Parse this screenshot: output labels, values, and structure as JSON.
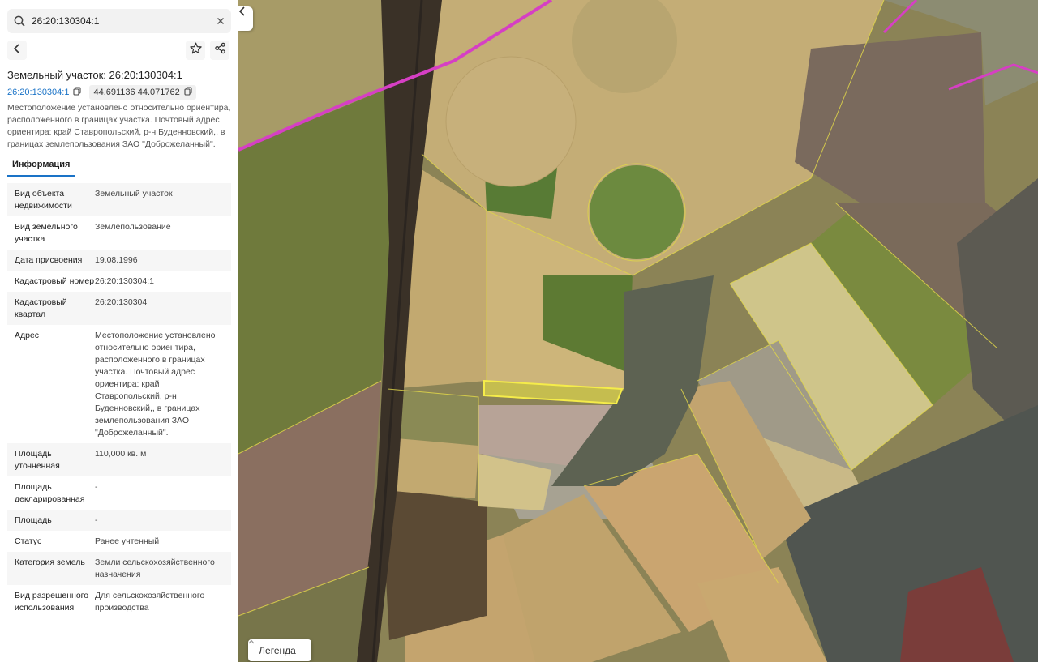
{
  "search": {
    "value": "26:20:130304:1",
    "search_icon": "search-icon",
    "clear_icon": "close-icon"
  },
  "panel": {
    "back_icon": "arrow-left-icon",
    "favorite_icon": "star-icon",
    "share_icon": "share-icon",
    "title": "Земельный участок: 26:20:130304:1",
    "cadastral_link": "26:20:130304:1",
    "coordinates": "44.691136 44.071762",
    "copy_icon": "copy-icon",
    "location_description": "Местоположение установлено относительно ориентира, расположенного в границах участка. Почтовый адрес ориентира: край Ставропольский, р-н Буденновский,, в границах землепользования ЗАО \"Доброжеланный\".",
    "tab_info": "Информация",
    "accent_color": "#1a73c7"
  },
  "info": [
    {
      "label": "Вид объекта недвижимости",
      "value": "Земельный участок"
    },
    {
      "label": "Вид земельного участка",
      "value": "Землепользование"
    },
    {
      "label": "Дата присвоения",
      "value": "19.08.1996"
    },
    {
      "label": "Кадастровый номер",
      "value": "26:20:130304:1"
    },
    {
      "label": "Кадастровый квартал",
      "value": "26:20:130304"
    },
    {
      "label": "Адрес",
      "value": "Местоположение установлено относительно ориентира, расположенного в границах участка. Почтовый адрес ориентира: край Ставропольский, р-н Буденновский,, в границах землепользования ЗАО \"Доброжеланный\"."
    },
    {
      "label": "Площадь уточненная",
      "value": "110,000 кв. м"
    },
    {
      "label": "Площадь декларированная",
      "value": "-"
    },
    {
      "label": "Площадь",
      "value": "-"
    },
    {
      "label": "Статус",
      "value": "Ранее учтенный"
    },
    {
      "label": "Категория земель",
      "value": "Земли сельскохозяйственного назначения"
    },
    {
      "label": "Вид разрешенного использования",
      "value": "Для сельскохозяйственного производства"
    }
  ],
  "map": {
    "collapse_icon": "chevron-left-icon",
    "legend_label": "Легенда",
    "legend_icon": "chevron-up-icon",
    "highlight_color": "#f5ec4a",
    "boundary_color": "#e0d64a",
    "road_color": "#d63fc4"
  }
}
